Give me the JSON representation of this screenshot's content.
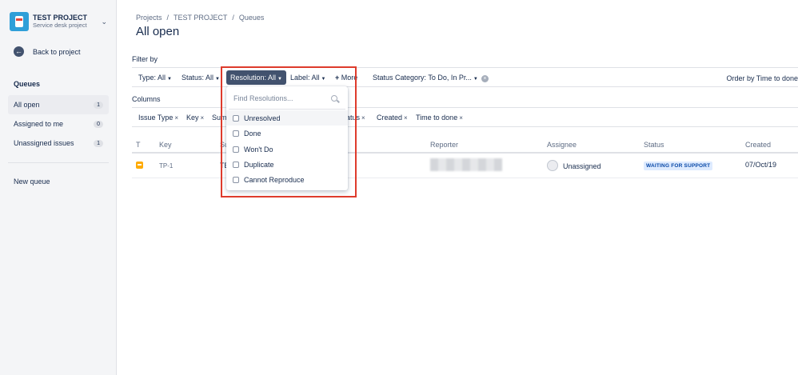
{
  "sidebar": {
    "project_name": "TEST PROJECT",
    "project_type": "Service desk project",
    "back_label": "Back to project",
    "queues_heading": "Queues",
    "items": [
      {
        "label": "All open",
        "count": "1"
      },
      {
        "label": "Assigned to me",
        "count": "0"
      },
      {
        "label": "Unassigned issues",
        "count": "1"
      }
    ],
    "new_queue_label": "New queue"
  },
  "breadcrumb": [
    "Projects",
    "/",
    "TEST PROJECT",
    "/",
    "Queues"
  ],
  "page_title": "All open",
  "filter": {
    "heading": "Filter by",
    "type": "Type: All",
    "status": "Status: All",
    "resolution": "Resolution: All",
    "label": "Label: All",
    "more": "More",
    "status_category": "Status Category: To Do, In Pr...",
    "order_by": "Order by Time to done"
  },
  "columns": {
    "heading": "Columns",
    "chips": [
      "Issue Type",
      "Key",
      "Sum",
      "atus",
      "Created",
      "Time to done"
    ]
  },
  "table": {
    "headers": {
      "t": "T",
      "key": "Key",
      "summary": "Su",
      "reporter": "Reporter",
      "assignee": "Assignee",
      "status": "Status",
      "created": "Created"
    },
    "row": {
      "key": "TP-1",
      "summary": "TE",
      "assignee": "Unassigned",
      "status": "WAITING FOR SUPPORT",
      "created": "07/Oct/19"
    }
  },
  "resolution_dropdown": {
    "search_placeholder": "Find Resolutions...",
    "options": [
      "Unresolved",
      "Done",
      "Won't Do",
      "Duplicate",
      "Cannot Reproduce"
    ]
  },
  "colors": {
    "accent": "#42526e",
    "highlight": "#de3b2c",
    "status_bg": "#deebff",
    "status_text": "#0747a6"
  }
}
